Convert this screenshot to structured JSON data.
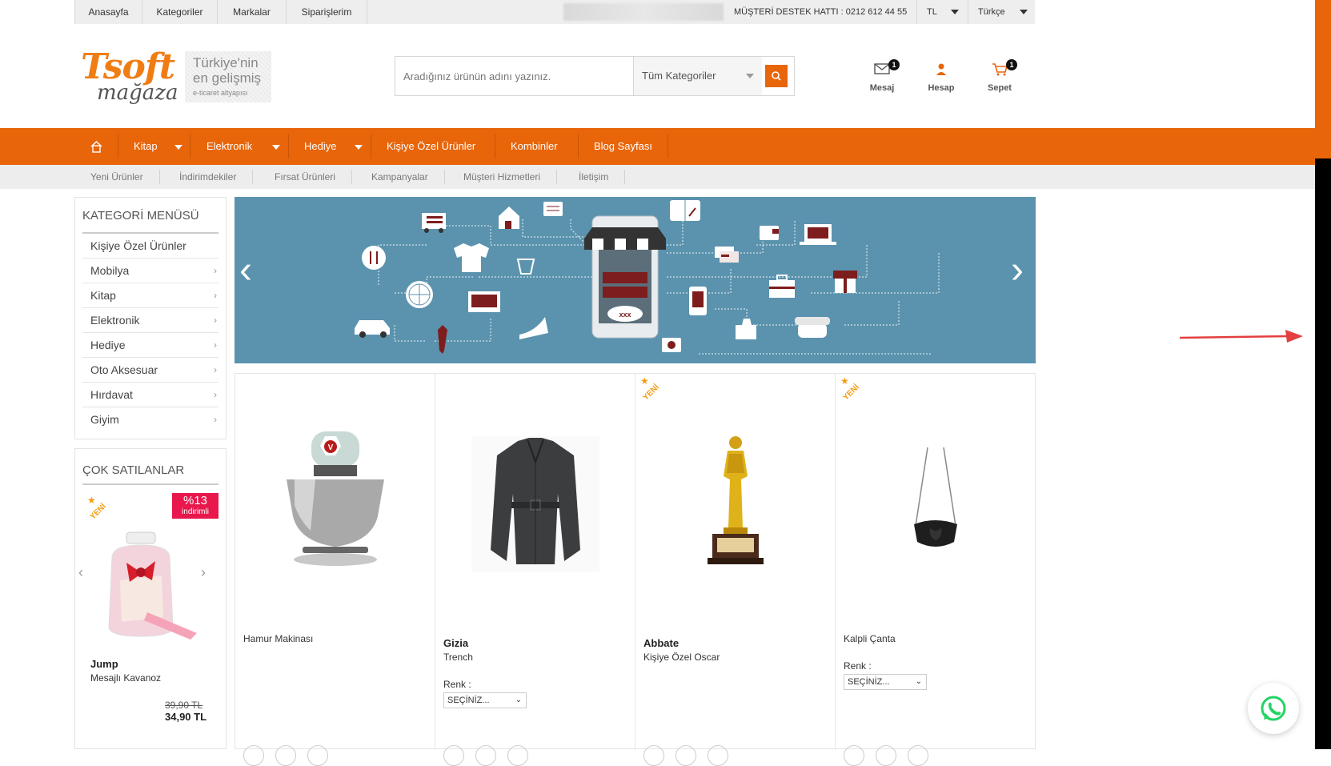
{
  "topbar": {
    "links": [
      "Anasayfa",
      "Kategoriler",
      "Markalar",
      "Siparişlerim"
    ],
    "hotline": "MÜŞTERİ DESTEK HATTI : 0212 612 44 55",
    "currency": "TL",
    "language": "Türkçe"
  },
  "logo": {
    "brand": "Tsoft",
    "sub": "mağaza",
    "tag_line1": "Türkiye'nin",
    "tag_line2": "en gelişmiş",
    "tag_line3": "e-ticaret altyapısı"
  },
  "search": {
    "placeholder": "Aradığınız ürünün adını yazınız.",
    "category": "Tüm Kategoriler"
  },
  "header_icons": [
    {
      "label": "Mesaj",
      "badge": "1"
    },
    {
      "label": "Hesap"
    },
    {
      "label": "Sepet",
      "badge": "1"
    }
  ],
  "main_nav": [
    "Kitap",
    "Elektronik",
    "Hediye",
    "Kişiye Özel Ürünler",
    "Kombinler",
    "Blog Sayfası"
  ],
  "sub_nav": [
    "Yeni Ürünler",
    "İndirimdekiler",
    "Fırsat Ürünleri",
    "Kampanyalar",
    "Müşteri Hizmetleri",
    "İletişim"
  ],
  "category_menu": {
    "title": "KATEGORİ MENÜSÜ",
    "items": [
      "Kişiye Özel Ürünler",
      "Mobilya",
      "Kitap",
      "Elektronik",
      "Hediye",
      "Oto Aksesuar",
      "Hırdavat",
      "Giyim"
    ]
  },
  "best_sellers": {
    "title": "ÇOK SATILANLAR",
    "discount_pct": "%13",
    "discount_label": "indirimli",
    "ribbon": "YENİ",
    "brand": "Jump",
    "name": "Mesajlı Kavanoz",
    "old_price": "39,90 TL",
    "new_price": "34,90 TL"
  },
  "products": [
    {
      "brand": "",
      "name": "Hamur Makinası",
      "new": false,
      "has_color": false
    },
    {
      "brand": "Gizia",
      "name": "Trench",
      "new": false,
      "has_color": true
    },
    {
      "brand": "Abbate",
      "name": "Kişiye Özel Oscar",
      "new": true,
      "has_color": false
    },
    {
      "brand": "",
      "name": "Kalpli Çanta",
      "new": true,
      "has_color": true
    }
  ],
  "product_ui": {
    "color_label": "Renk :",
    "select_placeholder": "SEÇİNİZ...",
    "ribbon": "YENİ"
  },
  "colors": {
    "accent": "#e8650a",
    "discount": "#e8174c",
    "banner": "#5b93ae"
  }
}
